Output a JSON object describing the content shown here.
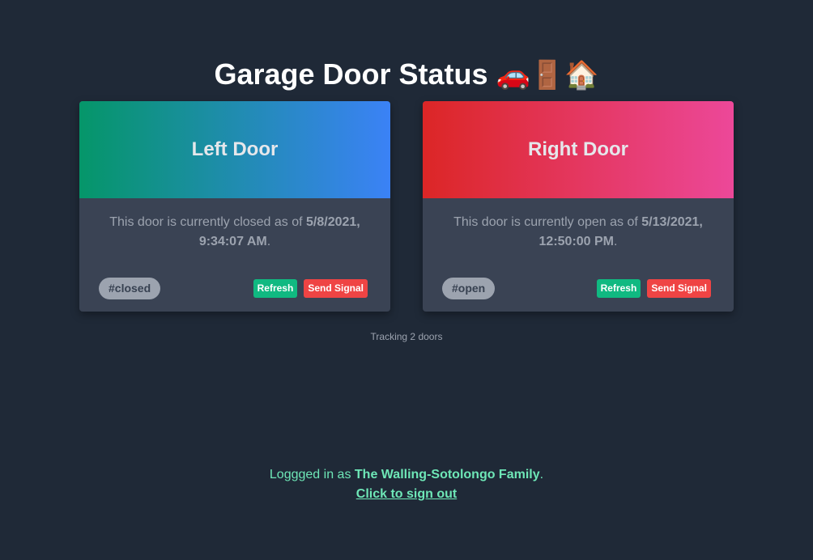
{
  "header": {
    "title": "Garage Door Status",
    "emoji": "🚗🚪🏠"
  },
  "doors": [
    {
      "name": "Left Door",
      "status_prefix": "This door is currently closed as of",
      "timestamp_date": "5/8/2021,",
      "timestamp_time": "9:34:07 AM",
      "tag": "#closed",
      "refresh_label": "Refresh",
      "signal_label": "Send Signal",
      "header_colors": [
        "#059669",
        "#3b82f6"
      ]
    },
    {
      "name": "Right Door",
      "status_prefix": "This door is currently open as of",
      "timestamp_date": "5/13/2021,",
      "timestamp_time": "12:50:00 PM",
      "tag": "#open",
      "refresh_label": "Refresh",
      "signal_label": "Send Signal",
      "header_colors": [
        "#dc2626",
        "#ec4899"
      ]
    }
  ],
  "tracking_text": "Tracking 2 doors",
  "footer": {
    "logged_in_prefix": "Loggged in as",
    "user": "The Walling-Sotolongo Family",
    "suffix": ".",
    "sign_out_label": "Click to sign out"
  },
  "colors": {
    "background": "#1f2937",
    "card": "#3a4354",
    "refresh": "#10b981",
    "signal": "#ef4444",
    "footer_text": "#6ee7b7"
  }
}
